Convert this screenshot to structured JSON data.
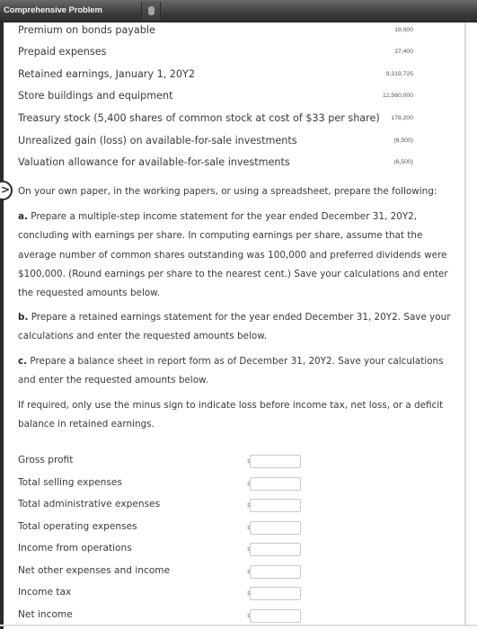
{
  "window": {
    "title": "Comprehensive Problem"
  },
  "accounts": [
    {
      "label": "Premium on bonds payable",
      "value": "19,000"
    },
    {
      "label": "Prepaid expenses",
      "value": "27,400"
    },
    {
      "label": "Retained earnings, January 1, 20Y2",
      "value": "9,319,725"
    },
    {
      "label": "Store buildings and equipment",
      "value": "12,560,000"
    },
    {
      "label": "Treasury stock (5,400 shares of common stock at cost of $33 per share)",
      "value": "178,200"
    },
    {
      "label": "Unrealized gain (loss) on available-for-sale investments",
      "value": "(6,500)"
    },
    {
      "label": "Valuation allowance for available-for-sale investments",
      "value": "(6,500)"
    }
  ],
  "instructions": {
    "intro": "On your own paper, in the working papers, or using a spreadsheet, prepare the following:",
    "part_a_prefix": "a.",
    "part_a": "Prepare a multiple-step income statement for the year ended December 31, 20Y2, concluding with earnings per share. In computing earnings per share, assume that the average number of common shares outstanding was 100,000 and preferred dividends were $100,000. (Round earnings per share to the nearest cent.) Save your calculations and enter the requested amounts below.",
    "part_b_prefix": "b.",
    "part_b": "Prepare a retained earnings statement for the year ended December 31, 20Y2. Save your calculations and enter the requested amounts below.",
    "part_c_prefix": "c.",
    "part_c": "Prepare a balance sheet in report form as of December 31, 20Y2. Save your calculations and enter the requested amounts below.",
    "note": "If required, only use the minus sign to indicate loss before income tax, net loss, or a deficit balance in retained earnings."
  },
  "answers": {
    "currency_symbol": "$",
    "rows": [
      {
        "label": "Gross profit",
        "value": ""
      },
      {
        "label": "Total selling expenses",
        "value": ""
      },
      {
        "label": "Total administrative expenses",
        "value": ""
      },
      {
        "label": "Total operating expenses",
        "value": ""
      },
      {
        "label": "Income from operations",
        "value": ""
      },
      {
        "label": "Net other expenses and income",
        "value": ""
      },
      {
        "label": "Income tax",
        "value": ""
      },
      {
        "label": "Net income",
        "value": ""
      }
    ]
  },
  "icons": {
    "expand_toggle": ">"
  }
}
